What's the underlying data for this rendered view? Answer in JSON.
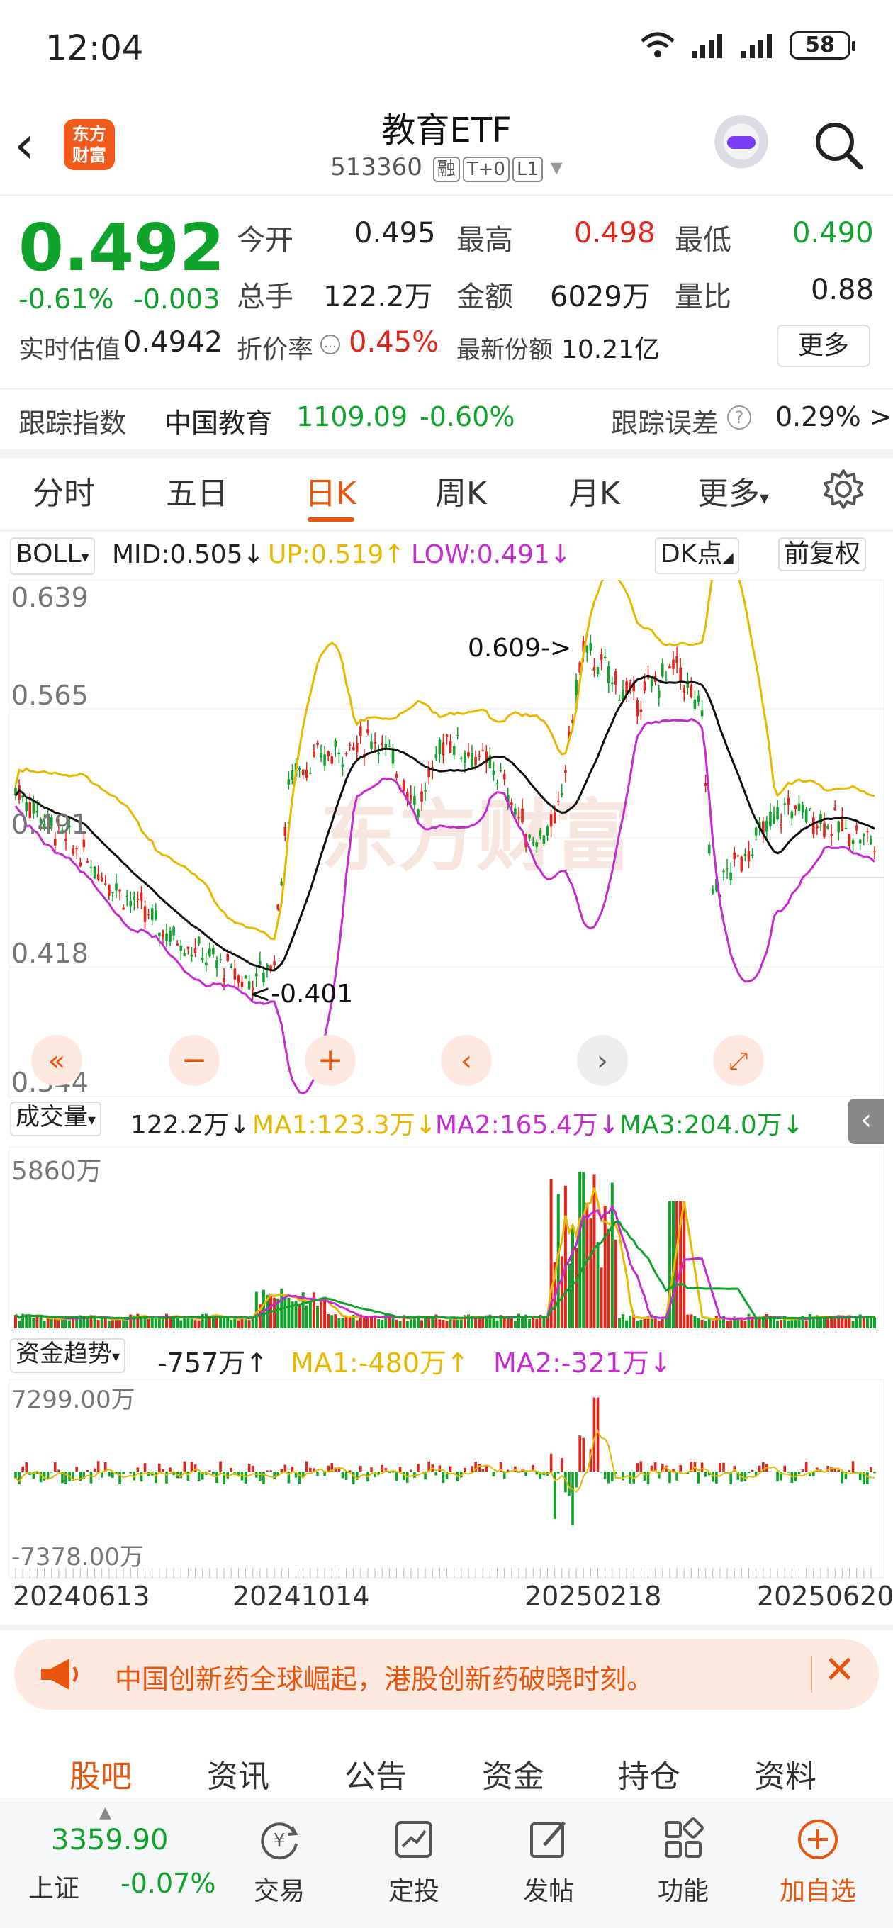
{
  "status_bar": {
    "time": "12:04",
    "battery": "58"
  },
  "header": {
    "logo_text_top": "东方",
    "logo_text_bottom": "财富",
    "title": "教育ETF",
    "code": "513360",
    "tags": [
      "融",
      "T+0",
      "L1"
    ]
  },
  "quote": {
    "price": "0.492",
    "change_pct": "-0.61%",
    "change": "-0.003",
    "open_label": "今开",
    "open": "0.495",
    "high_label": "最高",
    "high": "0.498",
    "low_label": "最低",
    "low": "0.490",
    "volume_label": "总手",
    "volume": "122.2万",
    "amount_label": "金额",
    "amount": "6029万",
    "ratio_label": "量比",
    "ratio": "0.88",
    "est_label": "实时估值",
    "est": "0.4942",
    "discount_label": "折价率",
    "discount": "0.45%",
    "shares_label": "最新份额",
    "shares": "10.21亿",
    "more_label": "更多"
  },
  "tracking": {
    "label": "跟踪指数",
    "index_name": "中国教育",
    "index_value": "1109.09",
    "index_change": "-0.60%",
    "error_label": "跟踪误差",
    "error_value": "0.29% >"
  },
  "period_tabs": [
    "分时",
    "五日",
    "日K",
    "周K",
    "月K",
    "更多"
  ],
  "active_tab": "日K",
  "chart_controls": {
    "indicator": "BOLL",
    "mid": "MID:0.505↓",
    "up": "UP:0.519↑",
    "low": "LOW:0.491↓",
    "dk": "DK点",
    "adjust": "前复权",
    "y_ticks": [
      "0.639",
      "0.565",
      "0.491",
      "0.418",
      "0.344"
    ],
    "annotation_high": "0.609->",
    "annotation_low": "<-0.401",
    "volume_label": "成交量",
    "volume_value": "122.2万↓",
    "vol_ma1": "MA1:123.3万↓",
    "vol_ma2": "MA2:165.4万↓",
    "vol_ma3": "MA3:204.0万↓",
    "volume_max": "5860万",
    "fund_label": "资金趋势",
    "fund_value": "-757万↑",
    "fund_ma1": "MA1:-480万↑",
    "fund_ma2": "MA2:-321万↓",
    "fund_max": "7299.00万",
    "fund_min": "-7378.00万",
    "x_ticks": [
      "20240613",
      "20241014",
      "20250218",
      "20250620"
    ]
  },
  "colors": {
    "up": "#e0261b",
    "down": "#10a32b",
    "boll_up": "#e8b800",
    "boll_low": "#c52bd1",
    "accent": "#e8560e"
  },
  "banner": {
    "text": "中国创新药全球崛起，港股创新药破晓时刻。"
  },
  "section_tabs": [
    "股吧",
    "资讯",
    "公告",
    "资金",
    "持仓",
    "资料"
  ],
  "bottom_bar": {
    "index_value": "3359.90",
    "index_name": "上证",
    "index_change": "-0.07%",
    "items": [
      "交易",
      "定投",
      "发帖",
      "功能",
      "加自选"
    ]
  }
}
